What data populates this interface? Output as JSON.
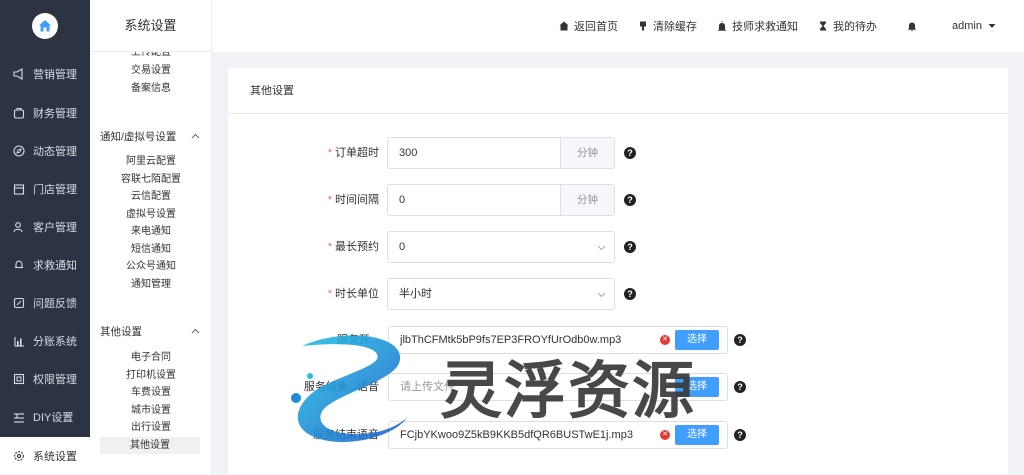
{
  "nav": {
    "items": [
      {
        "label": "营销管理",
        "icon": "megaphone-icon"
      },
      {
        "label": "财务管理",
        "icon": "wallet-icon"
      },
      {
        "label": "动态管理",
        "icon": "compass-icon"
      },
      {
        "label": "门店管理",
        "icon": "store-icon"
      },
      {
        "label": "客户管理",
        "icon": "users-icon"
      },
      {
        "label": "求救通知",
        "icon": "bell-icon"
      },
      {
        "label": "问题反馈",
        "icon": "feedback-icon"
      },
      {
        "label": "分账系统",
        "icon": "chart-icon"
      },
      {
        "label": "权限管理",
        "icon": "permission-icon"
      },
      {
        "label": "DIY设置",
        "icon": "diy-icon"
      },
      {
        "label": "系统设置",
        "icon": "gear-icon"
      }
    ]
  },
  "submenu": {
    "title": "系统设置",
    "group1_items": [
      "上传配置",
      "交易设置",
      "备案信息"
    ],
    "group2": {
      "label": "通知/虚拟号设置",
      "items": [
        "阿里云配置",
        "容联七陌配置",
        "云信配置",
        "虚拟号设置",
        "来电通知",
        "短信通知",
        "公众号通知",
        "通知管理"
      ]
    },
    "group3": {
      "label": "其他设置",
      "items": [
        "电子合同",
        "打印机设置",
        "车费设置",
        "城市设置",
        "出行设置",
        "其他设置"
      ]
    }
  },
  "header": {
    "home": "返回首页",
    "clear_cache": "清除缓存",
    "rescue": "技师求救通知",
    "todo": "我的待办",
    "user": "admin"
  },
  "panel": {
    "title": "其他设置",
    "order_timeout": {
      "label": "订单超时",
      "value": "300",
      "unit": "分钟"
    },
    "interval": {
      "label": "时间间隔",
      "value": "0",
      "unit": "分钟"
    },
    "max_booking": {
      "label": "最长预约",
      "value": "0"
    },
    "duration_unit": {
      "label": "时长单位",
      "value": "半小时"
    },
    "audio1": {
      "label": "服务开...",
      "file": "jlbThCFMtk5bP9fs7EP3FROYfUrOdb0w.mp3"
    },
    "audio2": {
      "label": "服务结束...语音",
      "placeholder": "请上传文件"
    },
    "audio3": {
      "label": "服务结束语音",
      "file": "FCjbYKwoo9Z5kB9KKB5dfQR6BUSTwE1j.mp3"
    },
    "pick_label": "选择",
    "help": "?"
  },
  "watermark": {
    "text": "灵浮资源"
  }
}
